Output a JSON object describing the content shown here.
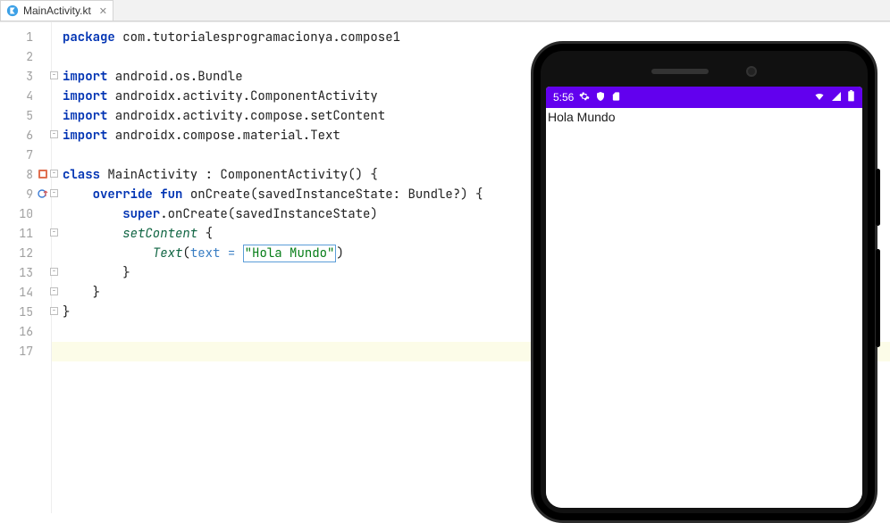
{
  "tab": {
    "filename": "MainActivity.kt",
    "icon": "kotlin-file-icon"
  },
  "code": {
    "lines": [
      {
        "n": 1,
        "kw1": "package",
        "rest": " com.tutorialesprogramacionya.compose1"
      },
      {
        "n": 2,
        "blank": true
      },
      {
        "n": 3,
        "kw1": "import",
        "rest": " android.os.Bundle"
      },
      {
        "n": 4,
        "kw1": "import",
        "rest": " androidx.activity.ComponentActivity"
      },
      {
        "n": 5,
        "kw1": "import",
        "rest": " androidx.activity.compose.setContent"
      },
      {
        "n": 6,
        "kw1": "import",
        "rest": " androidx.compose.material.Text"
      },
      {
        "n": 7,
        "blank": true
      },
      {
        "n": 8,
        "class_kw": "class",
        "class_name": " MainActivity : ComponentActivity() {"
      },
      {
        "n": 9,
        "indent": "    ",
        "override_kw": "override",
        "fun_kw": " fun",
        "fn_name": " onCreate",
        "params_open": "(savedInstanceState: ",
        "param_type": "Bundle?",
        "params_close": ") {"
      },
      {
        "n": 10,
        "indent": "        ",
        "super_kw": "super",
        "rest": ".onCreate(savedInstanceState)"
      },
      {
        "n": 11,
        "indent": "        ",
        "call_italic": "setContent",
        "rest": " {"
      },
      {
        "n": 12,
        "indent": "            ",
        "call_italic": "Text",
        "paren_open": "(",
        "arg_name": "text = ",
        "str": "\"Hola Mundo\"",
        "paren_close": ")"
      },
      {
        "n": 13,
        "indent": "        ",
        "rest": "}"
      },
      {
        "n": 14,
        "indent": "    ",
        "rest": "}"
      },
      {
        "n": 15,
        "rest": "}"
      },
      {
        "n": 16,
        "blank": true
      },
      {
        "n": 17,
        "blank": true,
        "current": true
      }
    ]
  },
  "phone": {
    "time": "5:56",
    "app_text": "Hola Mundo"
  }
}
